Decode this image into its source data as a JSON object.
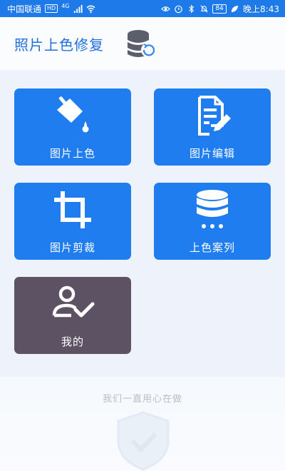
{
  "status_bar": {
    "carrier": "中国联通",
    "hd_badge": "HD",
    "signal_text": "4G",
    "battery": "84",
    "time": "晚上8:43"
  },
  "header": {
    "title": "照片上色修复"
  },
  "tiles": [
    {
      "label": "图片上色",
      "icon": "paint-bucket-icon"
    },
    {
      "label": "图片编辑",
      "icon": "document-edit-icon"
    },
    {
      "label": "图片剪裁",
      "icon": "crop-icon"
    },
    {
      "label": "上色案列",
      "icon": "database-icon"
    },
    {
      "label": "我的",
      "icon": "user-check-icon"
    }
  ],
  "footer": {
    "slogan": "我们一直用心在做"
  },
  "colors": {
    "status_bar": "#1e7ae8",
    "title": "#1f6fe0",
    "tile_blue": "#1f7df0",
    "tile_profile": "#5d5263",
    "background": "#eef3fb"
  }
}
